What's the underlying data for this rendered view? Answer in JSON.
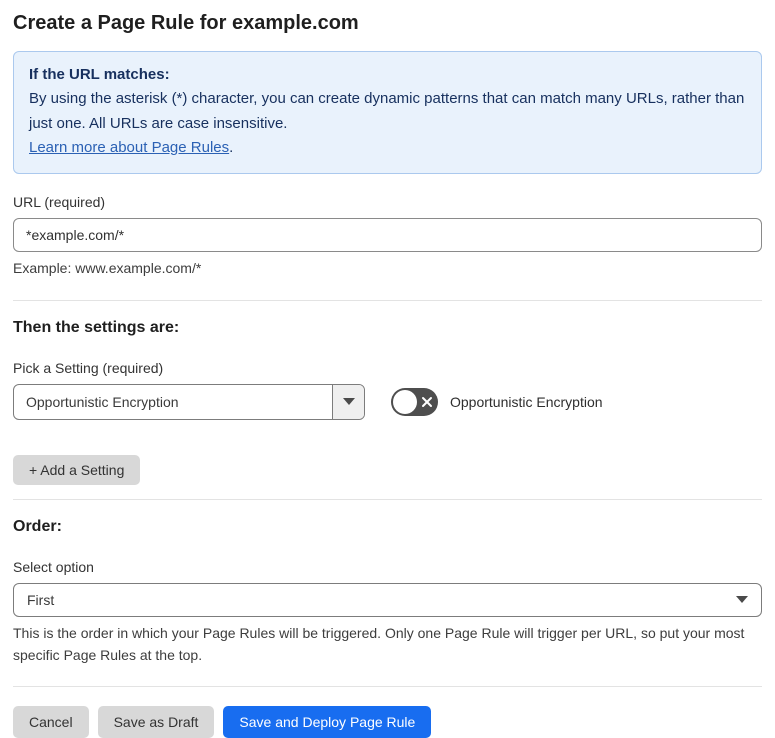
{
  "page": {
    "title": "Create a Page Rule for example.com"
  },
  "info_box": {
    "heading": "If the URL matches:",
    "body": "By using the asterisk (*) character, you can create dynamic patterns that can match many URLs, rather than just one. All URLs are case insensitive.",
    "link_label": "Learn more about Page Rules",
    "link_suffix": "."
  },
  "url_field": {
    "label": "URL (required)",
    "value": "*example.com/*",
    "helper": "Example: www.example.com/*"
  },
  "settings_section": {
    "heading": "Then the settings are:",
    "setting_label": "Pick a Setting (required)",
    "setting_value": "Opportunistic Encryption",
    "toggle_label": "Opportunistic Encryption",
    "toggle_state": "off",
    "add_setting_label": "+ Add a Setting"
  },
  "order_section": {
    "heading": "Order:",
    "select_label": "Select option",
    "select_value": "First",
    "helper": "This is the order in which your Page Rules will be triggered. Only one Page Rule will trigger per URL, so put your most specific Page Rules at the top."
  },
  "actions": {
    "cancel_label": "Cancel",
    "save_draft_label": "Save as Draft",
    "save_deploy_label": "Save and Deploy Page Rule"
  },
  "colors": {
    "info_bg": "#e9f2fc",
    "info_border": "#abc9ee",
    "info_text": "#17305e",
    "link": "#2b61b4",
    "primary_button": "#186df0",
    "secondary_button": "#d8d8d8",
    "toggle_off": "#4e4e4e"
  }
}
